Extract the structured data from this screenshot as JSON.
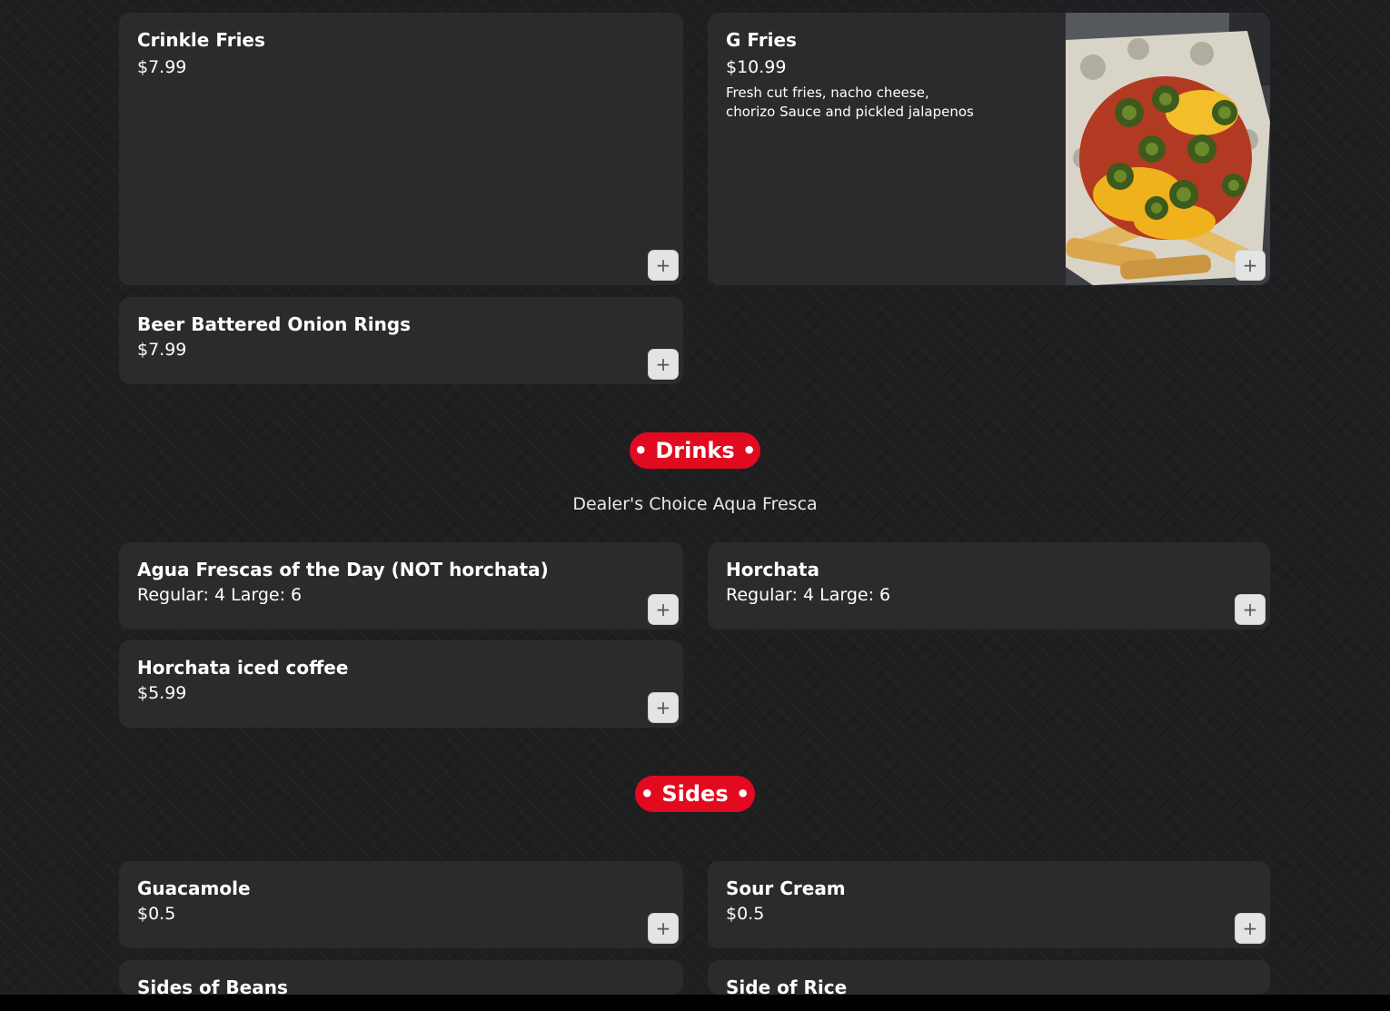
{
  "fries_items": [
    {
      "title": "Crinkle Fries",
      "price": "$7.99"
    },
    {
      "title": "G Fries",
      "price": "$10.99",
      "description_line1": "Fresh cut fries, nacho cheese,",
      "description_line2": "chorizo Sauce and pickled jalapenos"
    },
    {
      "title": "Beer Battered Onion Rings",
      "price": "$7.99"
    }
  ],
  "drinks": {
    "heading": "• Drinks •",
    "subtitle": "Dealer's Choice Aqua Fresca",
    "items": [
      {
        "title": "Agua Frescas of the Day (NOT horchata)",
        "price": "Regular: 4 Large: 6"
      },
      {
        "title": "Horchata",
        "price": "Regular: 4 Large: 6"
      },
      {
        "title": "Horchata iced coffee",
        "price": "$5.99"
      }
    ]
  },
  "sides": {
    "heading": "• Sides •",
    "items": [
      {
        "title": "Guacamole",
        "price": "$0.5"
      },
      {
        "title": "Sour Cream",
        "price": "$0.5"
      },
      {
        "title": "Sides of Beans"
      },
      {
        "title": "Side of Rice"
      }
    ]
  },
  "add_button_label": "+",
  "colors": {
    "accent": "#e10a1f",
    "card": "#2b2b2d",
    "background": "#1f1f22"
  }
}
